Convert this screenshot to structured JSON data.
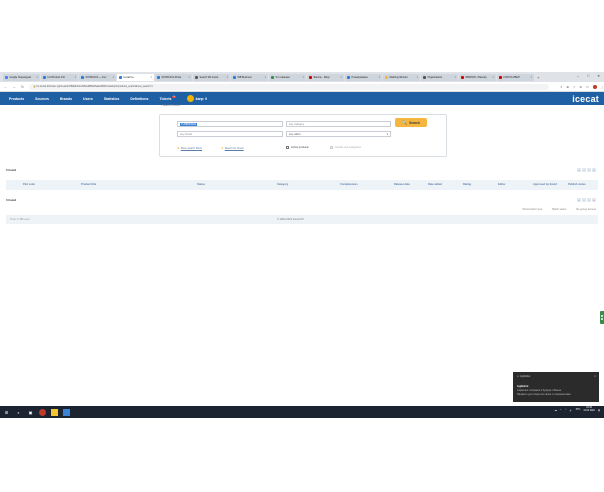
{
  "browser": {
    "tabs": [
      {
        "label": "Google Переводчик",
        "color": "#4285f4",
        "active": false
      },
      {
        "label": "Full Product Info",
        "color": "#2e7bd6",
        "active": false
      },
      {
        "label": "SOHAKAYA — Icec",
        "color": "#2e7bd6",
        "active": false
      },
      {
        "label": "Icecat Ice",
        "color": "#2e7bd6",
        "active": true
      },
      {
        "label": "SOHAKAYA Produ",
        "color": "#2e7bd6",
        "active": false
      },
      {
        "label": "Search Wit Icecat",
        "color": "#5a5a5a",
        "active": false
      },
      {
        "label": "WB Business",
        "color": "#2e7bd6",
        "active": false
      },
      {
        "label": "Что означает",
        "color": "#3a8d4a",
        "active": false
      },
      {
        "label": "Фасоль - Мкпр",
        "color": "#cc0000",
        "active": false
      },
      {
        "label": "Планирование",
        "color": "#2e7bd6",
        "active": false
      },
      {
        "label": "Markting Wonder",
        "color": "#f4b63f",
        "active": false
      },
      {
        "label": "Organizations",
        "color": "#555555",
        "active": false
      },
      {
        "label": "ИВАНИЯ - Ювелир",
        "color": "#cc0000",
        "active": false
      },
      {
        "label": "IVANIYA ИВАН",
        "color": "#cc0000",
        "active": false
      }
    ],
    "new_tab": "+",
    "window_controls": [
      "–",
      "□",
      "✕"
    ],
    "url": "bo.icecat.biz/index.cgi?sessid=8f6a0b13ec5d5ed8894c5a3e8f2b6c1e&tmpl=products_search&new_search=1"
  },
  "nav": {
    "items": [
      "Products",
      "Sources",
      "Brands",
      "Users",
      "Statistics",
      "Definitions"
    ],
    "tickets_label": "Tickets",
    "tickets_badge": "3",
    "user_label": "karp: 0",
    "logo": "icecat"
  },
  "breadcrumb": "Search product",
  "search": {
    "part_code_value": "TU38003202",
    "category_placeholder": "Any category",
    "brand_placeholder": "Any brand",
    "editor_select": "Any editor",
    "button_label": "Search",
    "options": {
      "more_filters": "More search filters",
      "report": "Report for brand",
      "active_products": "Active products",
      "include_sub": "Include sub categories"
    }
  },
  "results": {
    "top_count": "0 found",
    "bottom_count": "0 found",
    "pager": [
      "«",
      "‹",
      "›",
      "»"
    ],
    "columns": [
      "Part code",
      "Product title",
      "Status",
      "Category",
      "Completeness",
      "Release date",
      "Date added",
      "Rating",
      "Editor",
      "Approved by brand",
      "Publish status"
    ],
    "actions": [
      "Show batch input",
      "Batch select",
      "Re-group access"
    ]
  },
  "footer": {
    "time": "Time: 1.486 secs",
    "copyright": "© 2003-2022 Icecat NV"
  },
  "notification": {
    "app": "Lightshot",
    "title": "Lightshot",
    "body_line1": "Скриншот сохранён в буфере обмена",
    "body_line2": "Нажмите для открытия папки со скриншотами",
    "close": "✕"
  },
  "taskbar": {
    "clock_time": "10:44",
    "clock_date": "12.04.2022",
    "lang": "РУС"
  }
}
